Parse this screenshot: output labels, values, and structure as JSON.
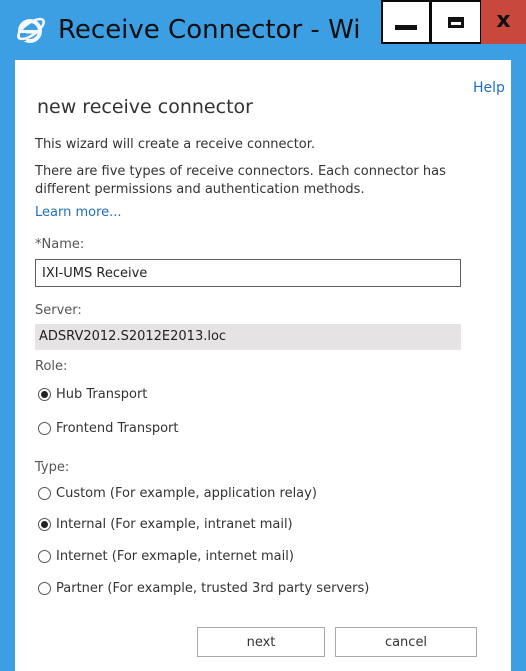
{
  "window": {
    "title": "Receive Connector - Wi",
    "minimize_glyph": "",
    "close_glyph": "x",
    "accent_color": "#3c9fe3",
    "close_color": "#c9483d"
  },
  "header": {
    "help_label": "Help",
    "heading": "new receive connector",
    "intro": "This wizard will create a receive connector.",
    "description": "There are five types of receive connectors. Each connector has different permissions and authentication methods.",
    "learn_more": "Learn more..."
  },
  "form": {
    "name_label": "*Name:",
    "name_value": "IXI-UMS Receive",
    "server_label": "Server:",
    "server_value": "ADSRV2012.S2012E2013.loc",
    "role_label": "Role:",
    "roles": [
      {
        "label": "Hub Transport",
        "checked": true
      },
      {
        "label": "Frontend Transport",
        "checked": false
      }
    ],
    "type_label": "Type:",
    "types": [
      {
        "label": "Custom (For example, application relay)",
        "checked": false
      },
      {
        "label": "Internal (For example, intranet mail)",
        "checked": true
      },
      {
        "label": "Internet (For exmaple, internet mail)",
        "checked": false
      },
      {
        "label": "Partner (For example, trusted 3rd party servers)",
        "checked": false
      }
    ]
  },
  "footer": {
    "next_label": "next",
    "cancel_label": "cancel"
  }
}
